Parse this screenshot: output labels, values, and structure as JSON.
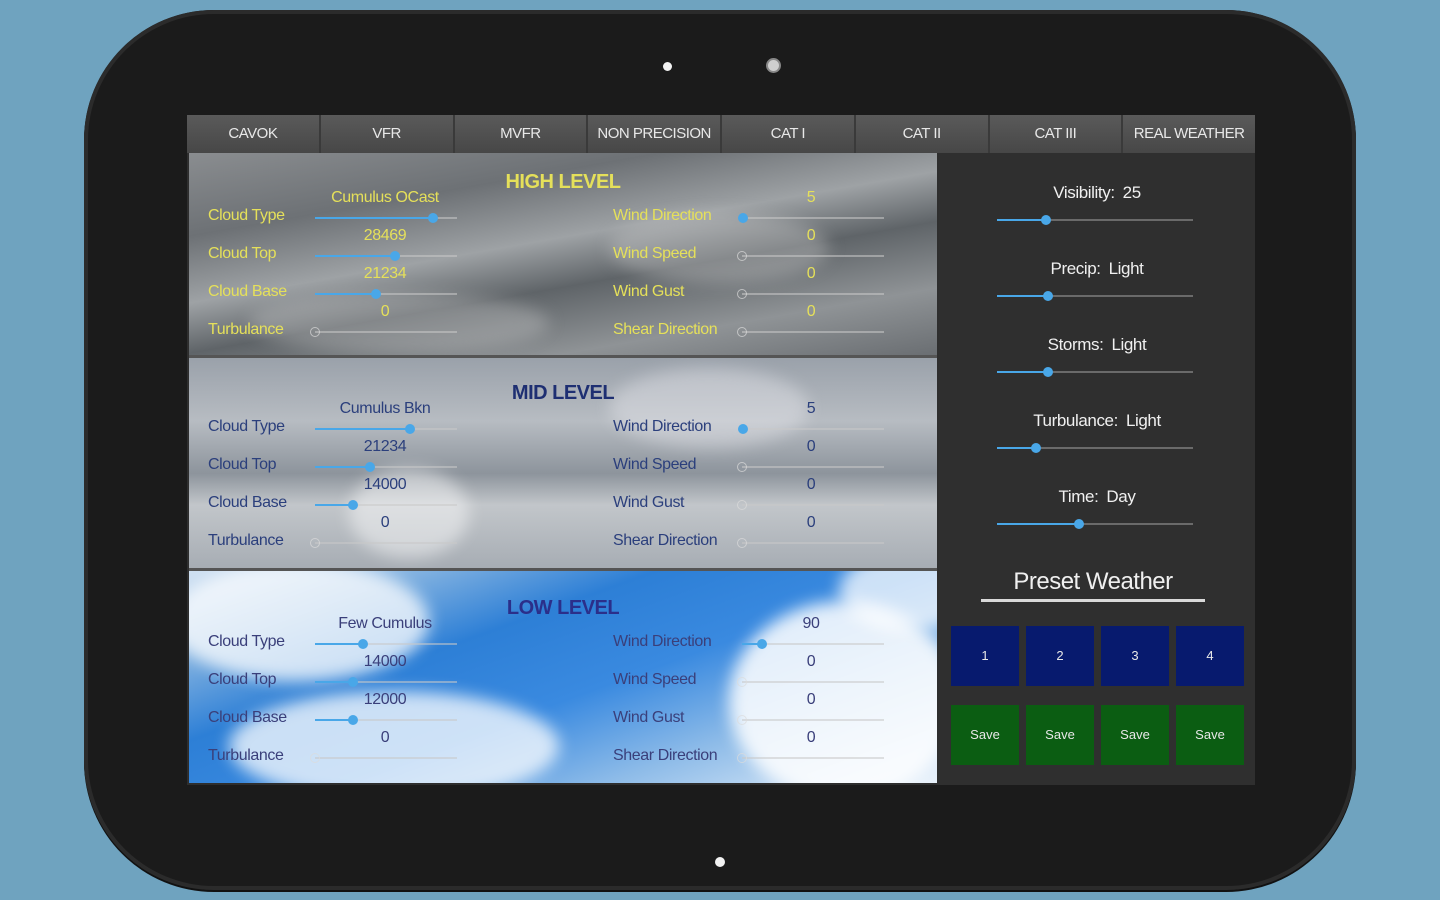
{
  "tabs": [
    "CAVOK",
    "VFR",
    "MVFR",
    "NON PRECISION",
    "CAT I",
    "CAT II",
    "CAT III",
    "REAL WEATHER"
  ],
  "high": {
    "title": "HIGH LEVEL",
    "left_labels": [
      "Cloud Type",
      "Cloud Top",
      "Cloud Base",
      "Turbulance"
    ],
    "left_values": [
      "Cumulus OCast",
      "28469",
      "21234",
      "0"
    ],
    "left_levels": [
      0.83,
      0.56,
      0.43,
      0.0
    ],
    "right_labels": [
      "Wind Direction",
      "Wind Speed",
      "Wind Gust",
      "Shear Direction"
    ],
    "right_values": [
      "5",
      "0",
      "0",
      "0"
    ],
    "right_levels": [
      0.01,
      0.0,
      0.0,
      0.0
    ]
  },
  "mid": {
    "title": "MID LEVEL",
    "left_labels": [
      "Cloud Type",
      "Cloud Top",
      "Cloud Base",
      "Turbulance"
    ],
    "left_values": [
      "Cumulus Bkn",
      "21234",
      "14000",
      "0"
    ],
    "left_levels": [
      0.67,
      0.39,
      0.27,
      0.0
    ],
    "right_labels": [
      "Wind Direction",
      "Wind Speed",
      "Wind Gust",
      "Shear Direction"
    ],
    "right_values": [
      "5",
      "0",
      "0",
      "0"
    ],
    "right_levels": [
      0.01,
      0.0,
      0.0,
      0.0
    ]
  },
  "low": {
    "title": "LOW LEVEL",
    "left_labels": [
      "Cloud Type",
      "Cloud Top",
      "Cloud Base",
      "Turbulance"
    ],
    "left_values": [
      "Few Cumulus",
      "14000",
      "12000",
      "0"
    ],
    "left_levels": [
      0.34,
      0.27,
      0.27,
      0.0
    ],
    "right_labels": [
      "Wind Direction",
      "Wind Speed",
      "Wind Gust",
      "Shear Direction"
    ],
    "right_values": [
      "90",
      "0",
      "0",
      "0"
    ],
    "right_levels": [
      0.14,
      0.0,
      0.0,
      0.0
    ]
  },
  "conditions": [
    {
      "label": "Visibility:",
      "value": "25",
      "level": 0.25
    },
    {
      "label": "Precip:",
      "value": "Light",
      "level": 0.26
    },
    {
      "label": "Storms:",
      "value": "Light",
      "level": 0.26
    },
    {
      "label": "Turbulance:",
      "value": "Light",
      "level": 0.2
    },
    {
      "label": "Time:",
      "value": "Day",
      "level": 0.42
    }
  ],
  "preset": {
    "title": "Preset Weather",
    "slots": [
      "1",
      "2",
      "3",
      "4"
    ],
    "save_label": "Save"
  },
  "colors": {
    "slider_accent": "#49a7e8",
    "preset_slot_bg": "#071a6e",
    "save_bg": "#0b5d12",
    "high_text": "#e5e05a"
  }
}
